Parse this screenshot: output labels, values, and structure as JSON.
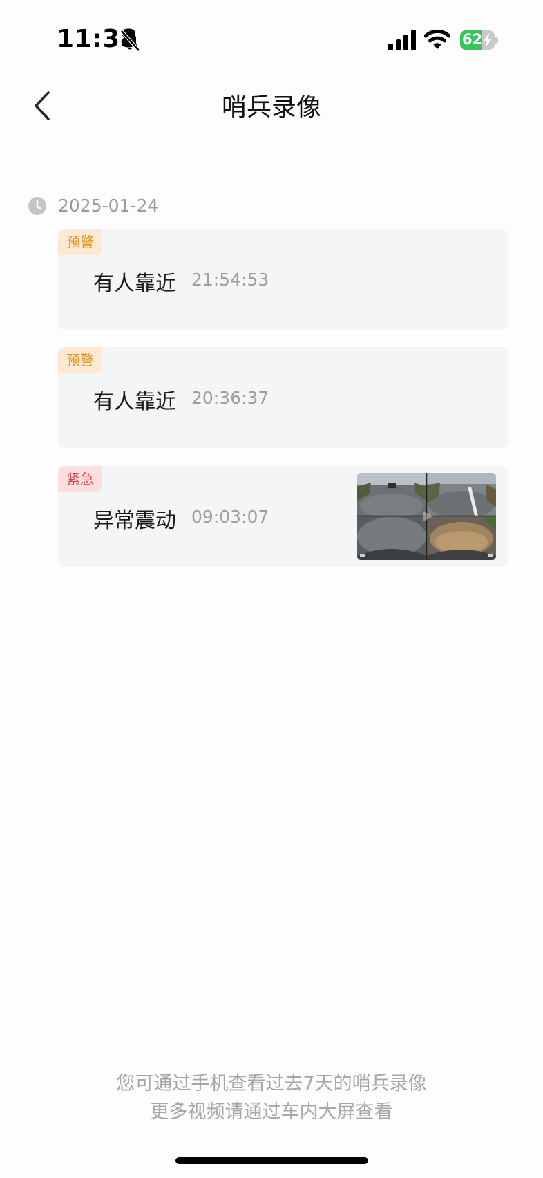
{
  "status_bar": {
    "time": "11:38",
    "battery_level": "62",
    "battery_fraction": 0.62,
    "battery_color": "#34c759"
  },
  "nav": {
    "back_icon": "chevron-left-icon",
    "title": "哨兵录像"
  },
  "date_group": {
    "icon": "clock-icon",
    "date": "2025-01-24"
  },
  "events": [
    {
      "tag": "预警",
      "tag_type": "warning",
      "title": "有人靠近",
      "time": "21:54:53",
      "has_thumbnail": false
    },
    {
      "tag": "预警",
      "tag_type": "warning",
      "title": "有人靠近",
      "time": "20:36:37",
      "has_thumbnail": false
    },
    {
      "tag": "紧急",
      "tag_type": "urgent",
      "title": "异常震动",
      "time": "09:03:07",
      "has_thumbnail": true
    }
  ],
  "colors": {
    "warning_tag_text": "#e8901a",
    "warning_tag_bg": "#fce9d3",
    "urgent_tag_text": "#e0474c",
    "urgent_tag_bg": "#fbdfe0"
  },
  "footer": {
    "line1": "您可通过手机查看过去7天的哨兵录像",
    "line2": "更多视频请通过车内大屏查看"
  }
}
